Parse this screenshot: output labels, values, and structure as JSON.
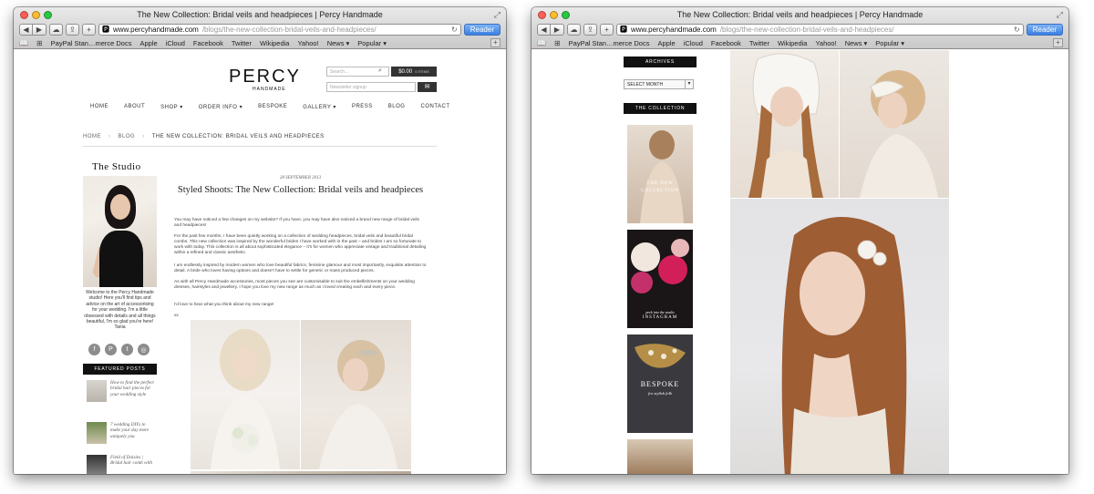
{
  "left_window": {
    "title": "The New Collection: Bridal veils and headpieces | Percy Handmade",
    "url_host": "www.percyhandmade.com",
    "url_path": "/blogs/the-new-collection-bridal-veils-and-headpieces/",
    "reader_label": "Reader",
    "bookmarks": [
      "PayPal Stan…merce Docs",
      "Apple",
      "iCloud",
      "Facebook",
      "Twitter",
      "Wikipedia",
      "Yahoo!",
      "News ▾",
      "Popular ▾"
    ],
    "site": {
      "logo": "PERCY",
      "logo_sub": "HANDMADE",
      "search_placeholder": "Search...",
      "cart_total": "$0.00",
      "cart_items": "0 ITEMS",
      "newsletter_placeholder": "Newsletter signup",
      "nav": [
        "HOME",
        "ABOUT",
        "SHOP ▾",
        "ORDER INFO ▾",
        "BESPOKE",
        "GALLERY ▾",
        "PRESS",
        "BLOG",
        "CONTACT"
      ],
      "breadcrumb": [
        "HOME",
        "BLOG",
        "THE NEW COLLECTION: BRIDAL VEILS AND HEADPIECES"
      ],
      "studio_title": "The Studio",
      "welcome": "Welcome to the Percy Handmade studio! Here you'll find tips and advice on the art of accessorising for your wedding. I'm a little obsessed with details and all things beautiful, I'm so glad you're here! Tania",
      "social_icons": [
        "facebook-icon",
        "pinterest-icon",
        "twitter-icon",
        "instagram-icon"
      ],
      "featured_heading": "FEATURED POSTS",
      "featured_posts": [
        "How to find the perfect bridal hair pieces for your wedding style",
        "7 wedding DIYs to make your day more uniquely you",
        "Field of Daisies | Bridal hair comb with"
      ],
      "post": {
        "date": "28 SEPTEMBER 2013",
        "title": "Styled Shoots: The New Collection: Bridal veils and headpieces",
        "paragraphs": [
          "You may have noticed a few changes on my website? If you have, you may have also noticed a brand new range of bridal veils and headpieces!",
          "For the past few months, I have been quietly working on a collection of wedding headpieces, bridal veils and beautiful bridal combs. This new collection was inspired by the wonderful brides I have worked with in the past – and brides I am so fortunate to work with today. This collection is all about sophisticated elegance – it's for women who appreciate vintage and traditional detailing within a refined and classic aesthetic.",
          "I am endlessly inspired by modern women who love beautiful fabrics, feminine glamour and most importantly, exquisite attention to detail. A bride who loves having options and doesn't have to settle for generic or mass produced pieces.",
          "As with all Percy Handmade accessories, most pieces you see are customisable to suit the embellishments on your wedding dresses, hairstyles and jewellery. I hope you love my new range as much as I loved creating each and every piece.",
          "I'd love to hear what you think about my new range!",
          "xx"
        ]
      }
    }
  },
  "right_window": {
    "title": "The New Collection: Bridal veils and headpieces | Percy Handmade",
    "url_host": "www.percyhandmade.com",
    "url_path": "/blogs/the-new-collection-bridal-veils-and-headpieces/",
    "reader_label": "Reader",
    "bookmarks": [
      "PayPal Stan…merce Docs",
      "Apple",
      "iCloud",
      "Facebook",
      "Twitter",
      "Wikipedia",
      "Yahoo!",
      "News ▾",
      "Popular ▾"
    ],
    "site": {
      "archives_heading": "ARCHIVES",
      "archives_select": "SELECT MONTH",
      "collection_heading": "THE COLLECTION",
      "tiles": [
        {
          "line1": "THE NEW",
          "line2": "COLLECTION"
        },
        {
          "line1": "peek into the studio",
          "line2": "INSTAGRAM"
        },
        {
          "line1": "BESPOKE",
          "line2": "for stylish folk"
        }
      ]
    }
  }
}
